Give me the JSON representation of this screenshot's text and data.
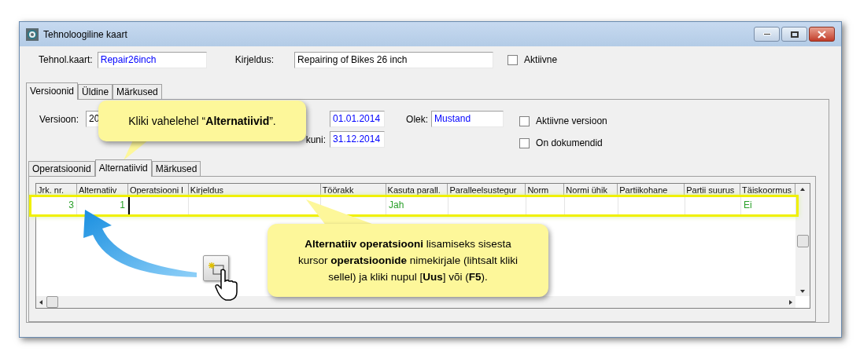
{
  "window": {
    "title": "Tehnoloogiline kaart"
  },
  "header": {
    "card": {
      "label": "Tehnol.kaart:",
      "value": "Repair26inch"
    },
    "description": {
      "label": "Kirjeldus:",
      "value": "Repairing of Bikes 26 inch"
    },
    "active": {
      "label": "Aktiivne",
      "checked": false
    }
  },
  "tabs": [
    {
      "label": "Versioonid",
      "selected": true
    },
    {
      "label": "Üldine",
      "selected": false
    },
    {
      "label": "Märkused",
      "selected": false
    }
  ],
  "version": {
    "version": {
      "label": "Versioon:",
      "value": "20"
    },
    "valid_from": {
      "value": "01.01.2014"
    },
    "valid_to": {
      "label": "kuni:",
      "value": "31.12.2014"
    },
    "status": {
      "label": "Olek:",
      "value": "Mustand"
    },
    "checkboxes": [
      {
        "label": "Aktiivne versioon",
        "checked": false
      },
      {
        "label": "On dokumendid",
        "checked": false
      }
    ]
  },
  "inner_tabs": [
    {
      "label": "Operatsioonid",
      "selected": false
    },
    {
      "label": "Alternatiivid",
      "selected": true
    },
    {
      "label": "Märkused",
      "selected": false
    }
  ],
  "table": {
    "columns": [
      "Jrk. nr.",
      "Alternatiiv",
      "Operatsiooni l",
      "Kirjeldus",
      "Töörakk",
      "Kasuta parall.",
      "Paralleelsustegur",
      "Norm",
      "Normi ühik",
      "Partiikohane",
      "Partii suurus",
      "Täiskoormus"
    ],
    "rows": [
      {
        "selected": true,
        "cells": [
          "3",
          "1",
          "",
          "",
          "",
          "Jah",
          "",
          "",
          "",
          "",
          "",
          "Ei"
        ]
      }
    ]
  },
  "callouts": [
    {
      "text": "Kliki vahelehel “**Alternatiivid**”."
    },
    {
      "text": "**Alternatiiv operatsiooni** lisamiseks sisesta kursor **operatsioonide** nimekirjale (lihtsalt kliki sellel) ja kliki nupul [**Uus**] või (**F5**)."
    }
  ]
}
